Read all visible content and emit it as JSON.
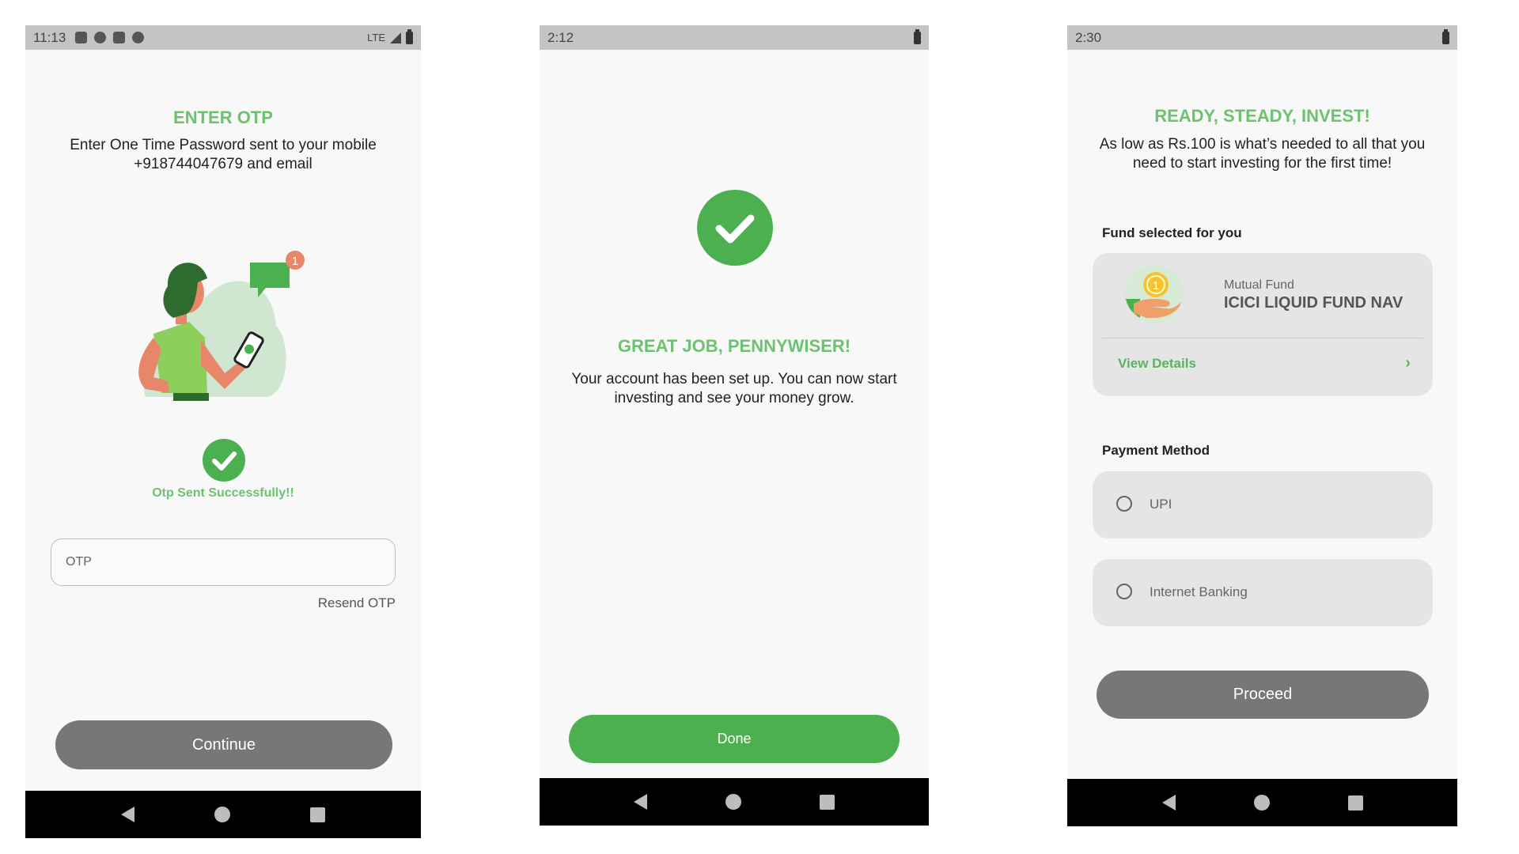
{
  "screens": [
    {
      "status_time": "11:13",
      "status_network": "LTE",
      "title": "ENTER OTP",
      "subtitle_line1": "Enter One Time Password sent to your mobile",
      "subtitle_line2": "+918744047679 and email",
      "notification_count": "1",
      "otp_status": "Otp Sent Successfully!!",
      "otp_placeholder": "OTP",
      "otp_value": "",
      "resend_label": "Resend OTP",
      "continue_label": "Continue"
    },
    {
      "status_time": "2:12",
      "title": "GREAT JOB, PENNYWISER!",
      "message_line1": "Your account has been set up. You can now start",
      "message_line2": "investing and see your money grow.",
      "done_label": "Done"
    },
    {
      "status_time": "2:30",
      "title": "READY, STEADY, INVEST!",
      "subtitle_line1": "As low as Rs.100 is what’s needed to all that you",
      "subtitle_line2": "need to start investing for the first time!",
      "fund_section_label": "Fund selected for you",
      "fund_type": "Mutual Fund",
      "fund_name": "ICICI LIQUID FUND NAV",
      "view_details_label": "View Details",
      "payment_section_label": "Payment Method",
      "payment_options": [
        {
          "label": "UPI",
          "selected": false
        },
        {
          "label": "Internet Banking",
          "selected": false
        }
      ],
      "proceed_label": "Proceed"
    }
  ],
  "colors": {
    "accent_green": "#6cc26f",
    "button_green": "#4caf50",
    "button_gray": "#777777",
    "card_bg": "#e5e5e5",
    "status_bar": "#c4c4c4",
    "nav_bar": "#000000"
  },
  "icons": {
    "status_bar_1": [
      "gmail-icon",
      "app-icon",
      "sd-card-icon",
      "chrome-icon",
      "signal-icon",
      "battery-icon"
    ],
    "nav_bar": [
      "back-icon",
      "home-icon",
      "recents-icon"
    ],
    "checkmark": "check-circle-icon",
    "fund": "coin-in-hand-icon"
  }
}
